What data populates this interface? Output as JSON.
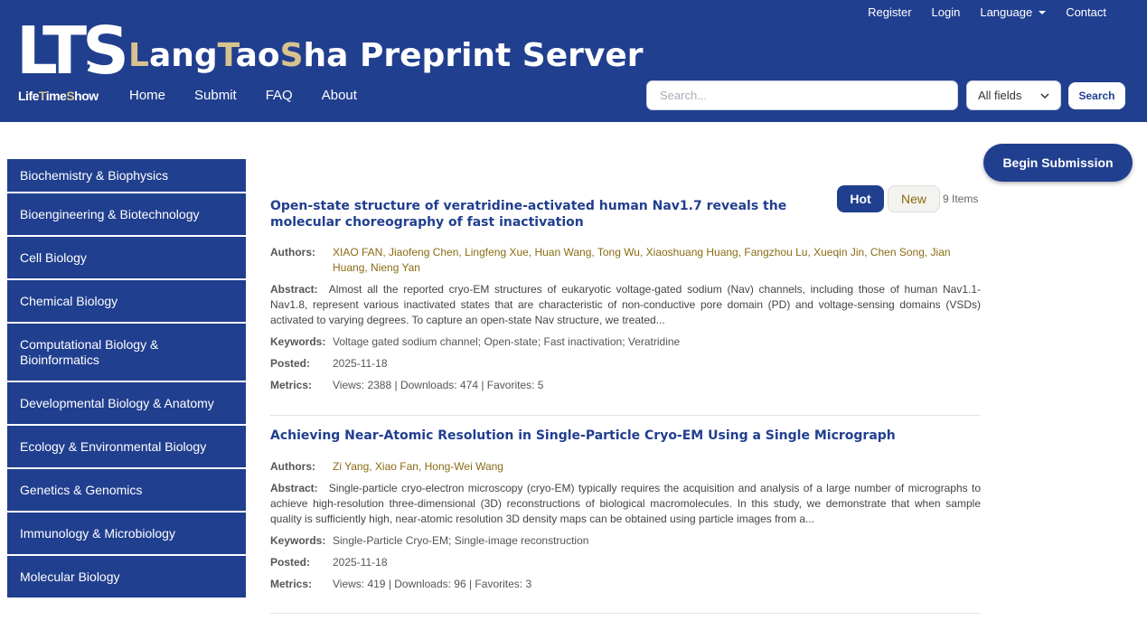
{
  "brand": {
    "logo_letters": "LTS",
    "logo_sub_a": "Life",
    "logo_sub_b": "T",
    "logo_sub_c": "ime",
    "logo_sub_d": "S",
    "logo_sub_e": "how",
    "title_parts": [
      "L",
      "ang",
      "T",
      "ao",
      "S",
      "ha Preprint Server"
    ],
    "gold": "#d8c38e",
    "navy": "#213f8f"
  },
  "top_nav": [
    "Register",
    "Login",
    "Language",
    "Contact"
  ],
  "main_nav": [
    "Home",
    "Submit",
    "FAQ",
    "About"
  ],
  "search": {
    "placeholder": "Search...",
    "field": "All fields",
    "button": "Search"
  },
  "sidebar": [
    "Biochemistry & Biophysics",
    "Bioengineering & Biotechnology",
    "Cell Biology",
    "Chemical Biology",
    "Computational Biology & Bioinformatics",
    "Developmental Biology & Anatomy",
    "Ecology & Environmental Biology",
    "Genetics & Genomics",
    "Immunology & Microbiology",
    "Molecular Biology"
  ],
  "begin_submission": "Begin Submission",
  "tabs": {
    "hot": "Hot",
    "new": "New",
    "count": "9 Items"
  },
  "labels": {
    "authors": "Authors:",
    "abstract": "Abstract:",
    "keywords": "Keywords:",
    "posted": "Posted:",
    "metrics": "Metrics:"
  },
  "articles": [
    {
      "title": "Open-state structure of veratridine-activated human Nav1.7 reveals the molecular choreography of fast inactivation",
      "authors": "XIAO FAN, Jiaofeng Chen, Lingfeng Xue, Huan Wang, Tong Wu, Xiaoshuang Huang, Fangzhou Lu, Xueqin Jin, Chen Song, Jian Huang, Nieng Yan",
      "abstract": "Almost all the reported cryo-EM structures of eukaryotic voltage-gated sodium (Nav) channels, including those of human Nav1.1-Nav1.8, represent various inactivated states that are characteristic of non-conductive pore domain (PD) and voltage-sensing domains (VSDs) activated to varying degrees. To capture an open-state Nav structure, we treated...",
      "keywords": "Voltage gated sodium channel; Open-state; Fast inactivation; Veratridine",
      "posted": "2025-11-18",
      "metrics": "Views: 2388 | Downloads: 474 | Favorites: 5"
    },
    {
      "title": "Achieving Near-Atomic Resolution in Single-Particle Cryo-EM Using a Single Micrograph",
      "authors": "Zi Yang, Xiao Fan, Hong-Wei Wang",
      "abstract": "Single-particle cryo-electron microscopy (cryo-EM) typically requires the acquisition and analysis of a large number of micrographs to achieve high-resolution three-dimensional (3D) reconstructions of biological macromolecules. In this study, we demonstrate that when sample quality is sufficiently high, near-atomic resolution 3D density maps can be obtained using particle images from a...",
      "keywords": "Single-Particle Cryo-EM; Single-image reconstruction",
      "posted": "2025-11-18",
      "metrics": "Views: 419 | Downloads: 96 | Favorites: 3"
    }
  ]
}
